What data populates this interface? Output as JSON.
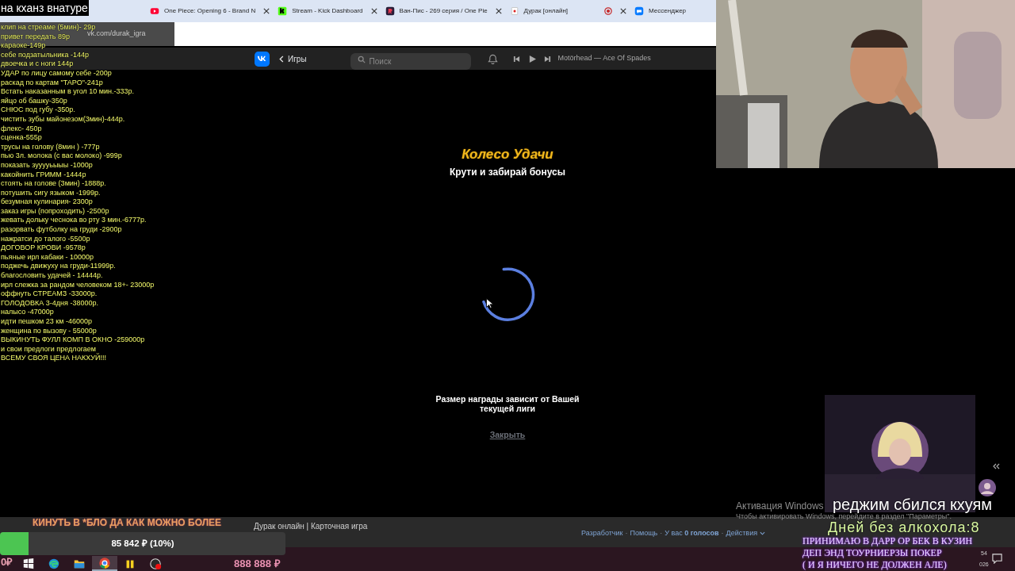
{
  "browser": {
    "tabs": [
      {
        "kind": "youtube",
        "title": "One Piece: Opening 6 - Brand N"
      },
      {
        "kind": "kick",
        "title": "Stream - Kick Dashboard"
      },
      {
        "kind": "anime",
        "title": "Ван-Пис - 269 серия / One Pie"
      },
      {
        "kind": "cards",
        "title": "Дурак [онлайн]"
      },
      {
        "kind": "messenger",
        "title": "Мессенджер"
      }
    ],
    "address": "vk.com/durak_igra"
  },
  "vk_header": {
    "back_label": "Игры",
    "search_placeholder": "Поиск",
    "track": "Motörhead — Ace Of Spades"
  },
  "modal": {
    "title": "Колесо Удачи",
    "subtitle": "Крути и забирай бонусы",
    "note": "Размер награды зависит от Вашей текущей лиги",
    "close": "Закрыть"
  },
  "footer": {
    "app_title": "Дурак онлайн | Карточная игра",
    "separator": "·",
    "links": [
      "Разработчик",
      "Помощь",
      "У вас **0 голосов**",
      "Действия"
    ]
  },
  "windows_activation": {
    "title": "Активация Windows",
    "hint": "Чтобы активировать Windows, перейдите в раздел \"Параметры\"."
  },
  "stream_overlay": {
    "caption": "на кханз внатуре",
    "price_list": [
      "клип на стреаме (5мин)- 29р",
      "привет передать 89р",
      "караоке-149р",
      "себе подзатыльника -144р",
      "двоечка и с ноги 144р",
      "УДАР по лицу самому себе -200р",
      "раскад по картам \"ТАРО\"-241р",
      "Встать наказанным в угол 10 мин.-333р.",
      "яйцо об башку-350р",
      "СНЮС под губу -350р.",
      "чистить зубы майонезом(3мин)-444р.",
      "флекс- 450р",
      "сценка-555р",
      "трусы на голову (8мин ) -777р",
      "пью 3л. молока (с вас молоко) -999р",
      "показать зууууьыыы -1000р",
      "какойнить ГРИММ -1444р",
      "стоять на голове (3мин) -1888р.",
      "потушить сигу языком -1999р.",
      "безумная кулинария- 2300р",
      "заказ игры (попроходить) -2500р",
      "жевать дольку чеснока во рту 3 мин.-6777р.",
      "разорвать футболку на груди -2900р",
      "нажратси до талого -5500р",
      "ДОГОВОР КРОВИ -9578р",
      "пьяные ирл кабаки - 10000р",
      "поджечь движуху на груди-11999р.",
      "благословить удачей - 14444р.",
      "ирл слежка за рандом человеком 18+- 23000р",
      "оффнуть СТРЕАМЗ -33000р.",
      "ГОЛОДОВКА 3-4дня -38000р.",
      "налысо -47000р",
      "идти пешком 23 км -46000р",
      "женщина по вызову - 55000р",
      "ВЫКИНУТЬ ФУЛЛ КОМП В ОКНО -259000р",
      "и свои предлоги предлогаем",
      "ВСЕМУ СВОЯ ЦЕНА НАКХУЙ!!!"
    ],
    "banner": "КИНУТЬ В *БЛО ДА КАК МОЖНО БОЛЕЕ",
    "donation_goal": {
      "text": "85 842 ₽ (10%)",
      "level": 0.1
    },
    "balance": "0₽",
    "total": "888 888 ₽",
    "status_text": "реджим сбился кхуям",
    "counter": "Дней без алкохола:8",
    "notice_lines": [
      "ПРИНИМАЮ В ДАРР ОР БЕК В КУЗИН",
      "ДЕП ЭНД ТОУРНИЕРЗЫ ПОКЕР",
      "( И Я НИЧЕГО НЕ ДОЛЖЕН АЛЕ)"
    ]
  },
  "taskbar": {
    "apps": [
      {
        "kind": "windows",
        "active": false
      },
      {
        "kind": "edge",
        "active": false
      },
      {
        "kind": "folder",
        "active": false
      },
      {
        "kind": "chrome",
        "active": true
      },
      {
        "kind": "pause",
        "active": false
      },
      {
        "kind": "recorder",
        "active": false
      }
    ],
    "clock": [
      "54",
      "026"
    ]
  }
}
